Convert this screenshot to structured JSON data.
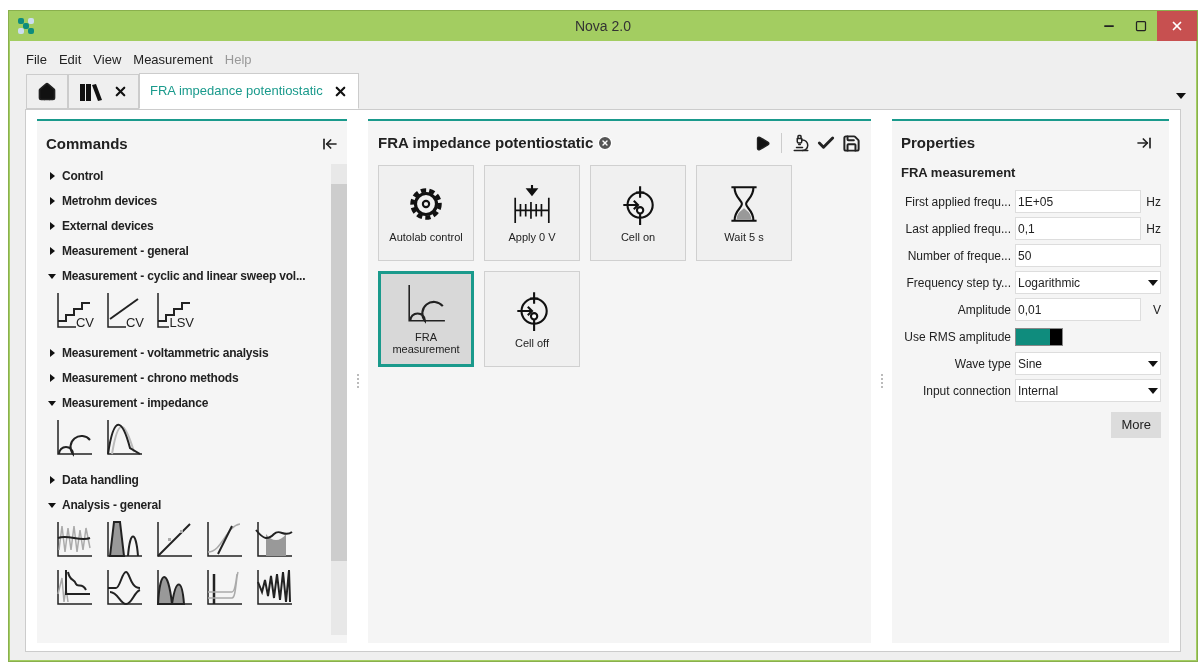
{
  "window": {
    "title": "Nova 2.0"
  },
  "menu": [
    {
      "label": "File",
      "disabled": false
    },
    {
      "label": "Edit",
      "disabled": false
    },
    {
      "label": "View",
      "disabled": false
    },
    {
      "label": "Measurement",
      "disabled": false
    },
    {
      "label": "Help",
      "disabled": true
    }
  ],
  "tabs": [
    {
      "kind": "home",
      "selected": false,
      "closable": false
    },
    {
      "kind": "library",
      "selected": false,
      "closable": true
    },
    {
      "kind": "document",
      "label": "FRA impedance potentiostatic",
      "selected": true,
      "closable": true
    }
  ],
  "commands": {
    "title": "Commands",
    "groups": [
      {
        "label": "Control",
        "expanded": false
      },
      {
        "label": "Metrohm devices",
        "expanded": false
      },
      {
        "label": "External devices",
        "expanded": false
      },
      {
        "label": "Measurement - general",
        "expanded": false
      },
      {
        "label": "Measurement - cyclic and linear sweep vol...",
        "expanded": true,
        "items": [
          {
            "kind": "staircase",
            "label": "CV"
          },
          {
            "kind": "ramp",
            "label": "CV"
          },
          {
            "kind": "staircase",
            "label": "LSV"
          }
        ]
      },
      {
        "label": "Measurement - voltammetric analysis",
        "expanded": false
      },
      {
        "label": "Measurement - chrono methods",
        "expanded": false
      },
      {
        "label": "Measurement - impedance",
        "expanded": true,
        "items": [
          {
            "kind": "nyquist"
          },
          {
            "kind": "peak-shift"
          }
        ]
      },
      {
        "label": "Data handling",
        "expanded": false
      },
      {
        "label": "Analysis - general",
        "expanded": true,
        "items": [
          {
            "kind": "smooth"
          },
          {
            "kind": "peak-area"
          },
          {
            "kind": "regression"
          },
          {
            "kind": "derivative"
          },
          {
            "kind": "integrate"
          },
          {
            "kind": "decay"
          },
          {
            "kind": "hysteresis"
          },
          {
            "kind": "double-peak"
          },
          {
            "kind": "baseline"
          },
          {
            "kind": "oscillation"
          }
        ]
      }
    ]
  },
  "procedure": {
    "title": "FRA impedance potentiostatic",
    "tiles": [
      {
        "kind": "gear",
        "label": "Autolab control",
        "selected": false
      },
      {
        "kind": "apply",
        "label": "Apply 0 V",
        "selected": false
      },
      {
        "kind": "cell",
        "label": "Cell on",
        "selected": false
      },
      {
        "kind": "hourglass",
        "label": "Wait 5 s",
        "selected": false
      },
      {
        "kind": "nyquist",
        "label": "FRA measurement",
        "selected": true
      },
      {
        "kind": "cell",
        "label": "Cell off",
        "selected": false
      }
    ]
  },
  "properties": {
    "title": "Properties",
    "section": "FRA measurement",
    "fields": [
      {
        "kind": "text",
        "label": "First applied frequ...",
        "value": "1E+05",
        "unit": "Hz"
      },
      {
        "kind": "text",
        "label": "Last applied frequ...",
        "value": "0,1",
        "unit": "Hz"
      },
      {
        "kind": "text",
        "label": "Number of freque...",
        "value": "50"
      },
      {
        "kind": "dropdown",
        "label": "Frequency step ty...",
        "value": "Logarithmic"
      },
      {
        "kind": "text",
        "label": "Amplitude",
        "value": "0,01",
        "unit": "V"
      },
      {
        "kind": "toggle",
        "label": "Use RMS amplitude",
        "on": true
      },
      {
        "kind": "dropdown",
        "label": "Wave type",
        "value": "Sine"
      },
      {
        "kind": "dropdown",
        "label": "Input connection",
        "value": "Internal"
      }
    ],
    "button": "More"
  }
}
